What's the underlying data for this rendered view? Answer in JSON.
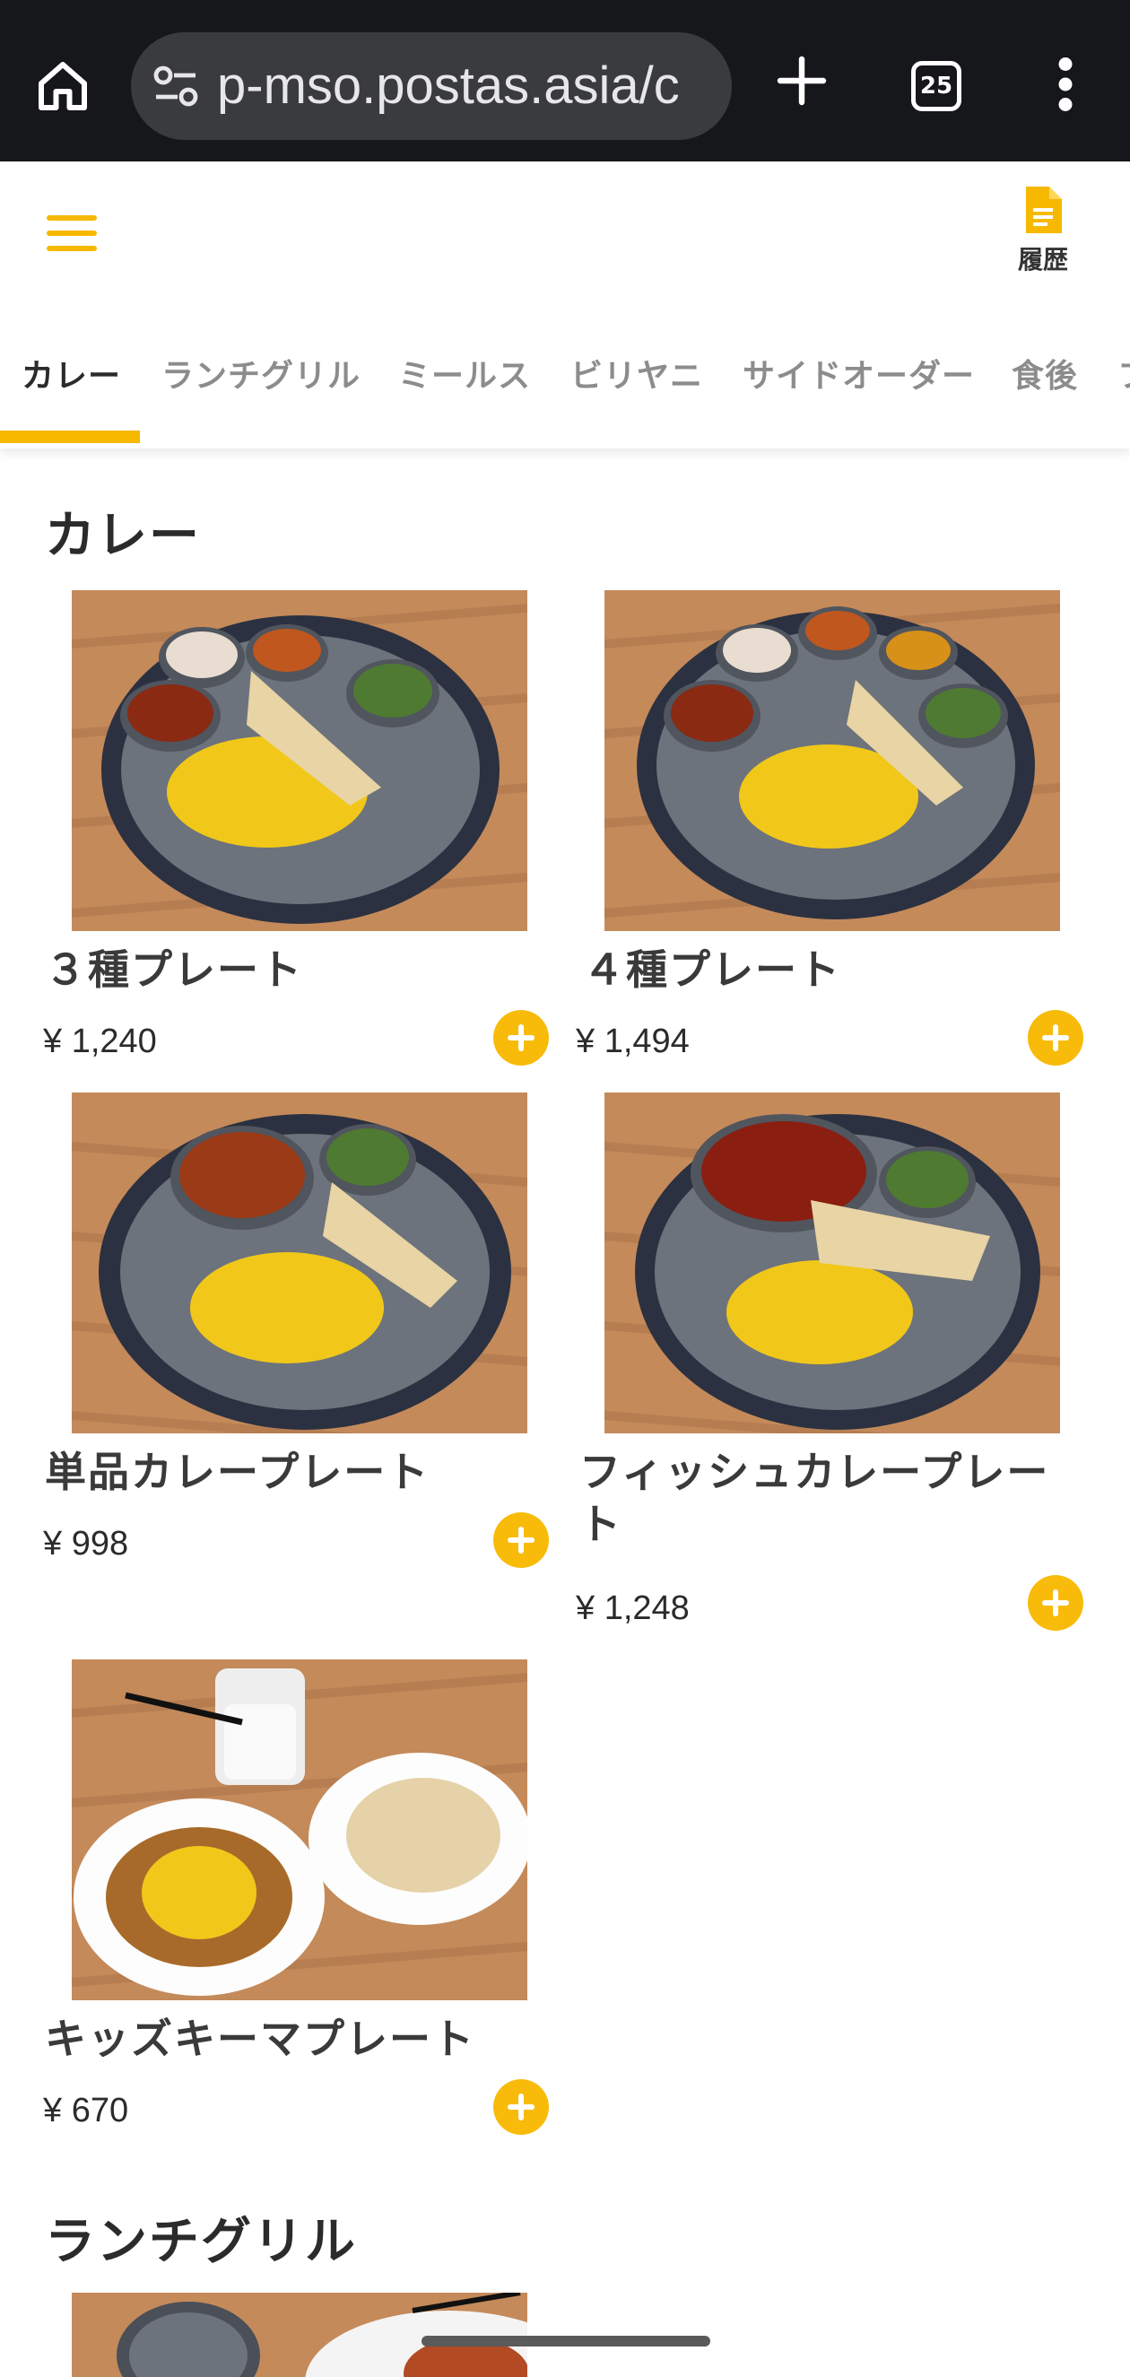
{
  "browser": {
    "url": "p-mso.postas.asia/c",
    "tab_count": "25",
    "icons": [
      "home-icon",
      "site-settings-icon",
      "new-tab-icon",
      "tab-switcher-icon",
      "more-vert-icon"
    ]
  },
  "header": {
    "history_label": "履歴",
    "accent_color": "#f6b900"
  },
  "categories": [
    {
      "label": "カレー",
      "active": true
    },
    {
      "label": "ランチグリル"
    },
    {
      "label": "ミールス"
    },
    {
      "label": "ビリヤニ"
    },
    {
      "label": "サイドオーダー"
    },
    {
      "label": "食後"
    },
    {
      "label": "フ"
    }
  ],
  "sections": [
    {
      "title": "カレー",
      "items": [
        {
          "name": "３種プレート",
          "price": "¥ 1,240"
        },
        {
          "name": "４種プレート",
          "price": "¥ 1,494"
        },
        {
          "name": "単品カレープレート",
          "price": "¥ 998"
        },
        {
          "name": "フィッシュカレープレート",
          "price": "¥ 1,248"
        },
        {
          "name": "キッズキーマプレート",
          "price": "¥ 670"
        }
      ]
    },
    {
      "title": "ランチグリル",
      "items": []
    }
  ]
}
